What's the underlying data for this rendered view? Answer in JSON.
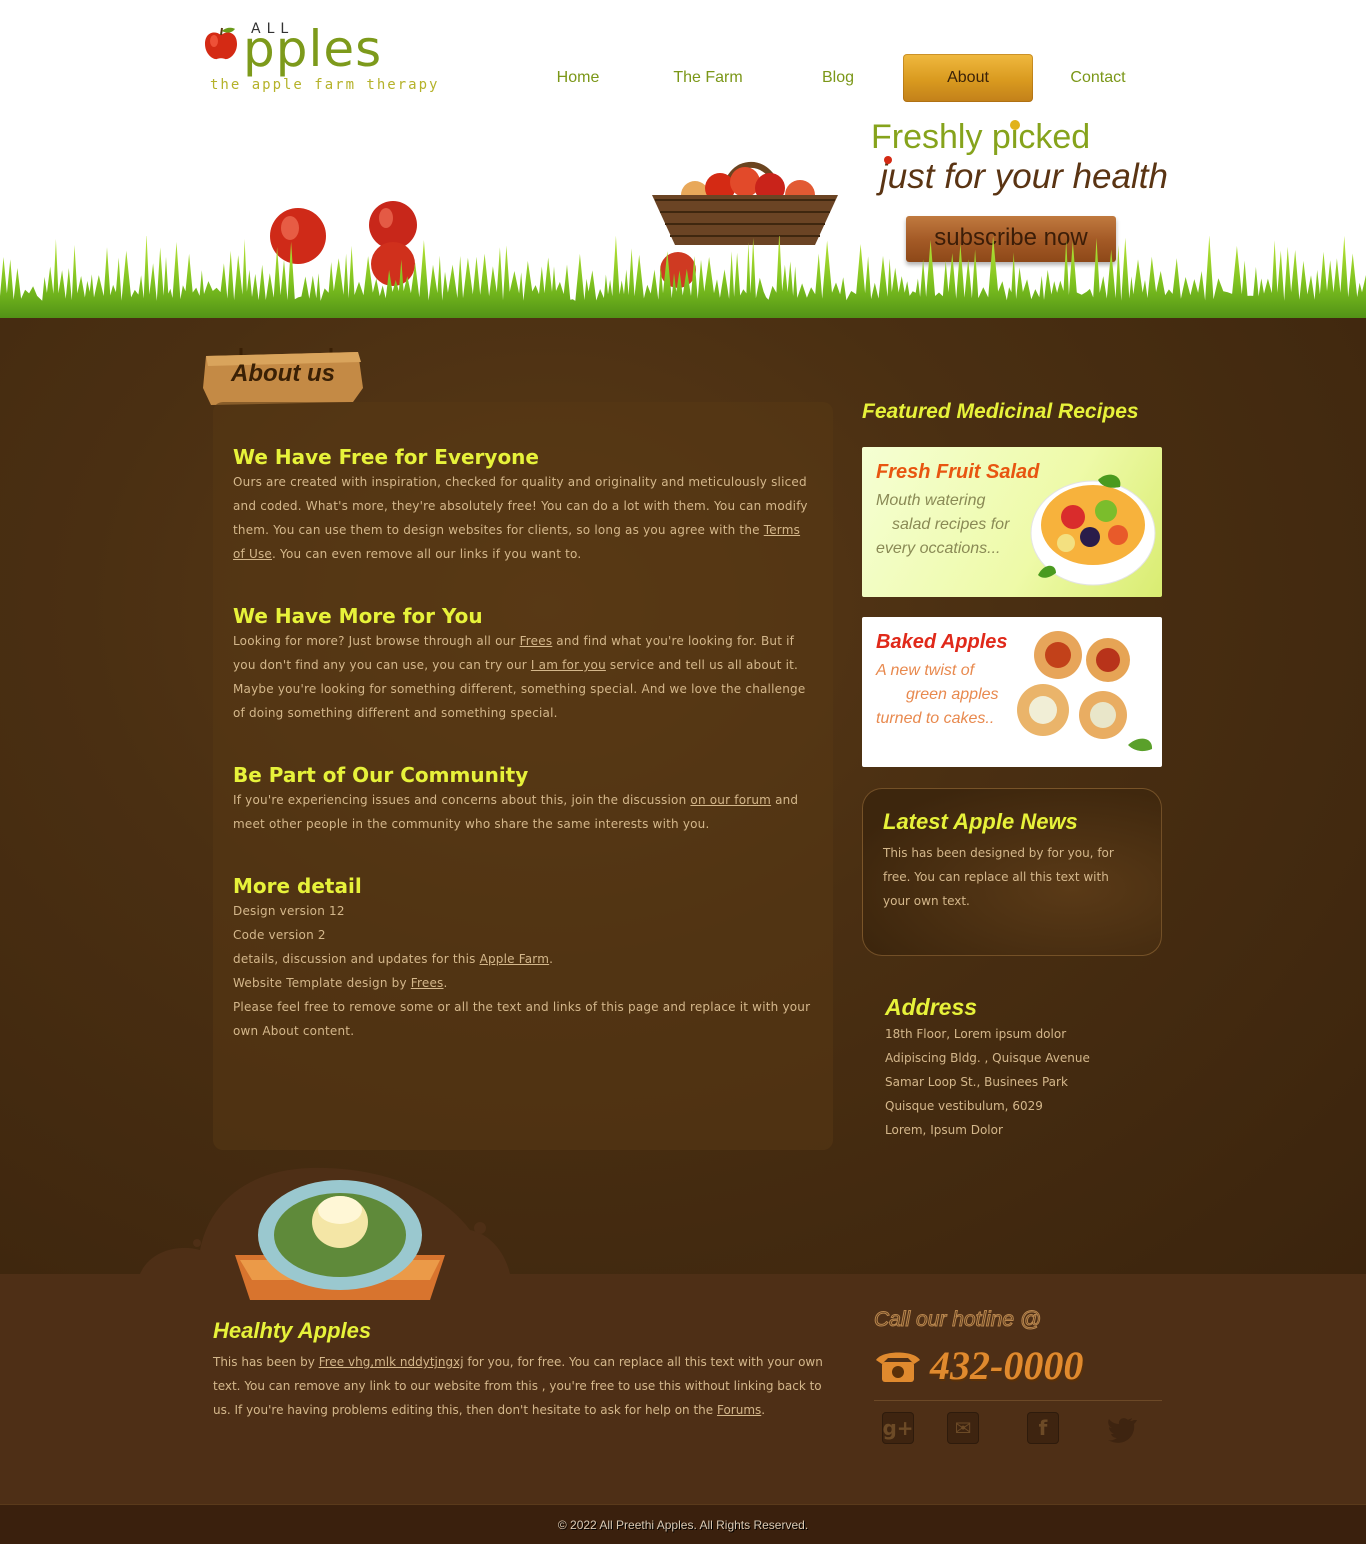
{
  "logo": {
    "all": "ALL",
    "word": "pples",
    "tagline": "the apple farm therapy"
  },
  "nav": [
    {
      "label": "Home",
      "active": false
    },
    {
      "label": "The Farm",
      "active": false
    },
    {
      "label": "Blog",
      "active": false
    },
    {
      "label": "About",
      "active": true
    },
    {
      "label": "Contact",
      "active": false
    }
  ],
  "hero": {
    "line1": "Freshly picked",
    "line2": "just for your health",
    "cta": "subscribe now"
  },
  "about_sign": "About us",
  "sections": [
    {
      "title": "We Have Free for Everyone",
      "p1": "Ours are created with inspiration, checked for quality and originality and meticulously sliced and coded. What's more, they're absolutely free! You can do a lot with them. You can modify them. You can use them to design websites for clients, so long as you agree with the ",
      "link": "Terms of Use",
      "p2": ". You can even remove all our links if you want to."
    },
    {
      "title": "We Have More for You",
      "p1": "Looking for more? Just browse through all our ",
      "link1": "Frees",
      "p2": " and find what you're looking for. But if you don't find any you can use, you can try our ",
      "link2": "I am for you",
      "p3": " service and tell us all about it. Maybe you're looking for something different, something special. And we love the challenge of doing something different and something special."
    },
    {
      "title": "Be Part of Our Community",
      "p1": "If you're experiencing issues and concerns about this, join the discussion ",
      "link": "on our forum",
      "p2": " and meet other people in the community who share the same interests with you."
    },
    {
      "title": "More detail",
      "line1": "Design version 12",
      "line2": "Code version 2",
      "line3a": "details, discussion and updates for this ",
      "line3link": "Apple Farm",
      "line3b": ".",
      "line4a": "Website Template design by ",
      "line4link": "Frees",
      "line4b": ".",
      "line5": "Please feel free to remove some or all the text and links of this page and replace it with your own About content."
    }
  ],
  "sidebar": {
    "title": "Featured Medicinal Recipes",
    "cards": [
      {
        "title": "Fresh Fruit Salad",
        "lines": [
          "Mouth watering",
          "salad recipes for",
          "every occations..."
        ],
        "title_color": "#e85510",
        "text_color": "#8a8a55"
      },
      {
        "title": "Baked Apples",
        "lines": [
          "A new twist of",
          "green apples",
          "turned to cakes.."
        ],
        "title_color": "#e0291a",
        "text_color": "#e8894e"
      }
    ],
    "news": {
      "title": "Latest Apple News",
      "text": "This has been designed by for you, for free. You can replace all this text with your own text."
    },
    "address": {
      "title": "Address",
      "lines": [
        "18th Floor, Lorem ipsum dolor",
        "Adipiscing Bldg. , Quisque Avenue",
        "Samar Loop St., Businees Park",
        "Quisque vestibulum, 6029",
        "Lorem, Ipsum Dolor"
      ]
    }
  },
  "footer": {
    "title": "Healhty Apples",
    "p1": "This has been by ",
    "link1": "Free vhg,mlk nddytjngxj",
    "p2": " for you, for free. You can replace all this text with your own text. You can remove any link to our website from this , you're free to use this without linking back to us. If you're having problems editing this, then don't hesitate to ask for help on the ",
    "link2": "Forums",
    "p3": ".",
    "hotline_label": "Call our hotline @",
    "phone": "432-0000",
    "social": [
      {
        "name": "google-plus-icon",
        "glyph": "g+"
      },
      {
        "name": "mail-icon",
        "glyph": "✉"
      },
      {
        "name": "facebook-icon",
        "glyph": "f"
      },
      {
        "name": "twitter-icon",
        "glyph": "🐦"
      }
    ],
    "copyright": "© 2022 All Preethi Apples. All Rights Reserved."
  }
}
